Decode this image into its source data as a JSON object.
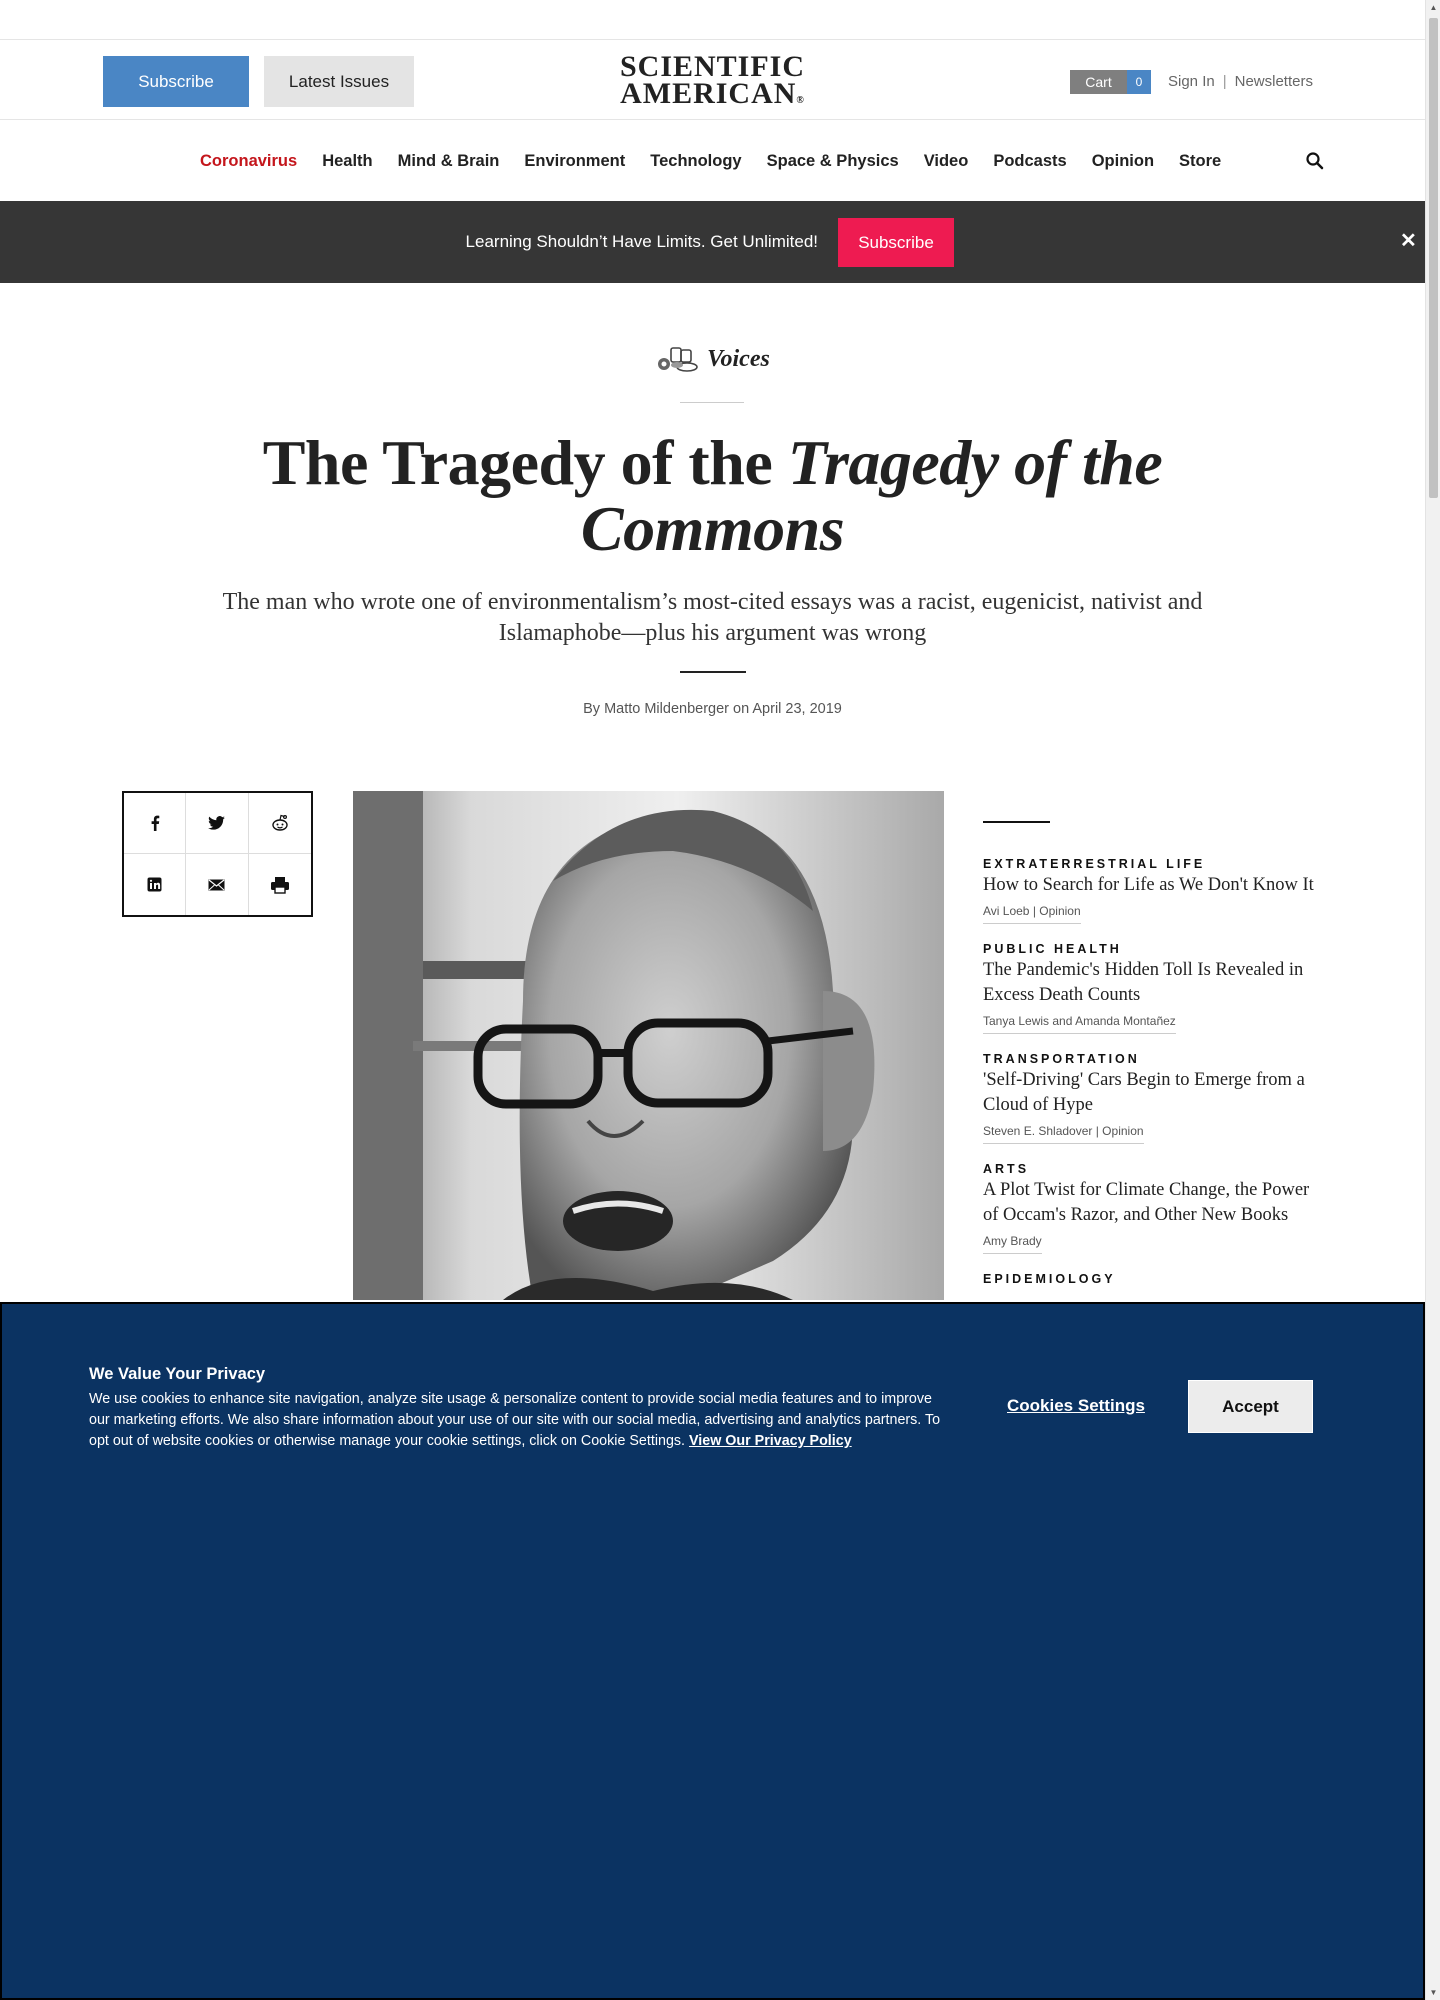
{
  "header": {
    "subscribe_label": "Subscribe",
    "latest_issues_label": "Latest Issues",
    "logo_line1": "SCIENTIFIC",
    "logo_line2": "AMERICAN",
    "logo_mark": "®",
    "cart_label": "Cart",
    "cart_count": "0",
    "sign_in_label": "Sign In",
    "separator": "|",
    "newsletters_label": "Newsletters"
  },
  "nav": {
    "items": [
      {
        "label": "Coronavirus"
      },
      {
        "label": "Health"
      },
      {
        "label": "Mind & Brain"
      },
      {
        "label": "Environment"
      },
      {
        "label": "Technology"
      },
      {
        "label": "Space & Physics"
      },
      {
        "label": "Video"
      },
      {
        "label": "Podcasts"
      },
      {
        "label": "Opinion"
      },
      {
        "label": "Store"
      }
    ],
    "search_icon": "search-icon",
    "hot_color": "#c4161c"
  },
  "promo": {
    "text": "Learning Shouldn’t Have Limits. Get Unlimited!",
    "button_label": "Subscribe",
    "close_glyph": "✕",
    "button_color": "#ee1b51"
  },
  "article": {
    "section": "Voices",
    "headline_plain": "The Tragedy of the ",
    "headline_italic": "Tragedy of the Commons",
    "dek": "The man who wrote one of environmentalism’s most-cited essays was a racist, eugenicist, nativist and Islamaphobe—plus his argument was wrong",
    "byline_prefix": "By",
    "author": "Matto Mildenberger",
    "byline_on": "on",
    "date": "April 23, 2019"
  },
  "share": {
    "icons": [
      "facebook-icon",
      "twitter-icon",
      "reddit-icon",
      "linkedin-icon",
      "email-icon",
      "print-icon"
    ]
  },
  "sidebar": {
    "items": [
      {
        "kicker": "EXTRATERRESTRIAL LIFE",
        "title": "How to Search for Life as We Don't Know It",
        "by": "Avi Loeb | Opinion"
      },
      {
        "kicker": "PUBLIC HEALTH",
        "title": "The Pandemic's Hidden Toll Is Revealed in Excess Death Counts",
        "by": "Tanya Lewis and Amanda Montañez"
      },
      {
        "kicker": "TRANSPORTATION",
        "title": "'Self-Driving' Cars Begin to Emerge from a Cloud of Hype",
        "by": "Steven E. Shladover | Opinion"
      },
      {
        "kicker": "ARTS",
        "title": "A Plot Twist for Climate Change, the Power of Occam's Razor, and Other New Books",
        "by": "Amy Brady"
      },
      {
        "kicker": "EPIDEMIOLOGY"
      }
    ]
  },
  "cookie": {
    "title": "We Value Your Privacy",
    "body": "We use cookies to enhance site navigation, analyze site usage & personalize content to provide social media features and to improve our marketing efforts. We also share information about your use of our site with our social media, advertising and analytics partners. To opt out of website cookies or otherwise manage your cookie settings, click on Cookie Settings.",
    "policy_link": "View Our Privacy Policy",
    "settings_label": "Cookies Settings",
    "accept_label": "Accept",
    "background": "#0b3362"
  }
}
